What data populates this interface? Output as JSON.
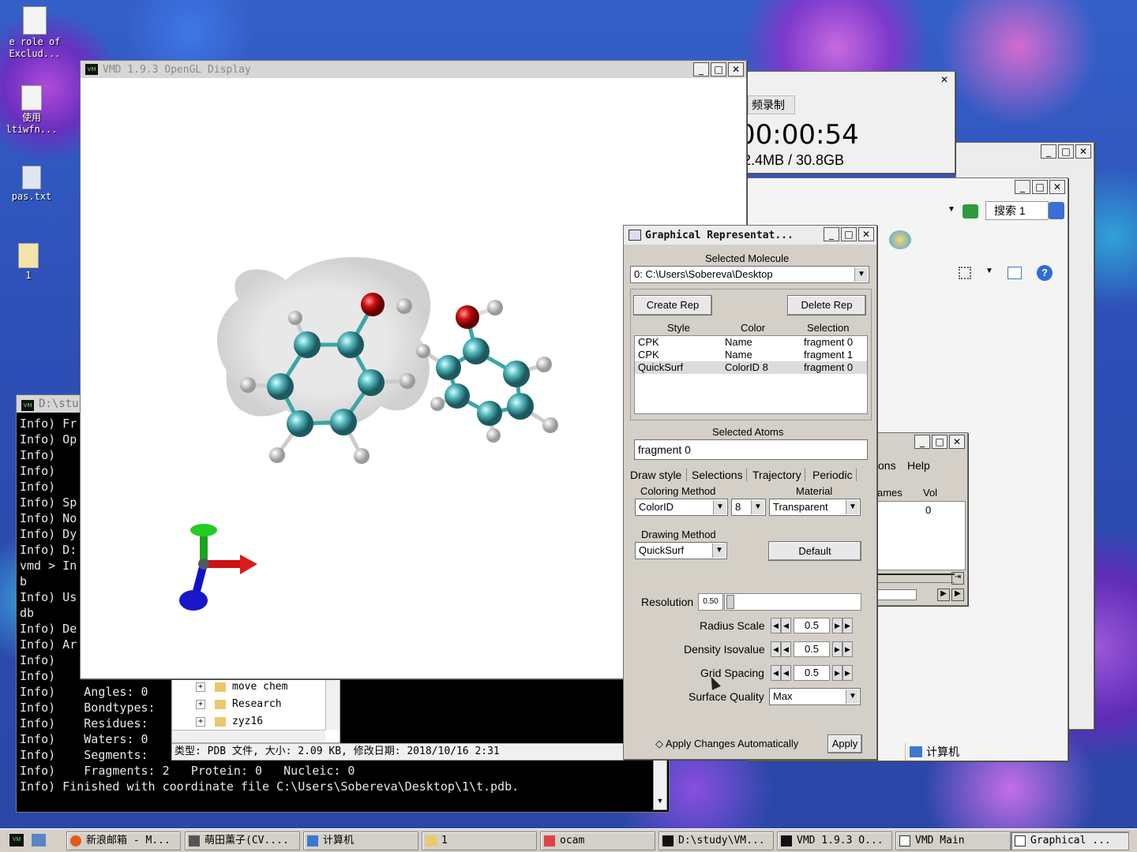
{
  "desktop_icons": [
    {
      "label1": "e role of",
      "label2": "Exclud..."
    },
    {
      "label1": "使用",
      "label2": "ltiwfn..."
    },
    {
      "label1": "pas.txt",
      "label2": ""
    },
    {
      "label1": "1",
      "label2": ""
    }
  ],
  "opengl": {
    "title": "VMD 1.9.3 OpenGL Display"
  },
  "recorder": {
    "tab": "频录制",
    "time": "00:00:54",
    "size": "2.4MB / 30.8GB"
  },
  "explorer": {
    "search_label": "搜索 1",
    "tree": [
      "move chem",
      "Research",
      "zyz16"
    ],
    "status": "类型: PDB 文件, 大小: 2.09 KB, 修改日期: 2018/10/16 2:31",
    "footer": "计算机"
  },
  "vmdmain": {
    "menu": [
      "ons",
      "Help"
    ],
    "cols": [
      "ames",
      "Vol"
    ],
    "vol": "0"
  },
  "terminal": {
    "title": "D:\\stu",
    "lines": [
      "Info) Fr",
      "Info) Op",
      "Info)",
      "Info)",
      "Info)",
      "Info) Sp",
      "Info) No",
      "Info) Dy",
      "Info) D:",
      "vmd > In",
      "b",
      "Info) Us",
      "db",
      "Info) De",
      "Info) Ar",
      "Info)",
      "Info)",
      "Info)    Angles: 0",
      "Info)    Bondtypes:",
      "Info)    Residues:",
      "Info)    Waters: 0",
      "Info)    Segments:",
      "Info)    Fragments: 2   Protein: 0   Nucleic: 0",
      "Info) Finished with coordinate file C:\\Users\\Sobereva\\Desktop\\1\\t.pdb."
    ]
  },
  "gr": {
    "title": "Graphical Representat...",
    "selected_molecule_label": "Selected Molecule",
    "selected_molecule": "0: C:\\Users\\Sobereva\\Desktop",
    "create_rep": "Create Rep",
    "delete_rep": "Delete Rep",
    "headers": {
      "style": "Style",
      "color": "Color",
      "selection": "Selection"
    },
    "reps": [
      {
        "style": "CPK",
        "color": "Name",
        "selection": "fragment 0"
      },
      {
        "style": "CPK",
        "color": "Name",
        "selection": "fragment 1"
      },
      {
        "style": "QuickSurf",
        "color": "ColorID 8",
        "selection": "fragment 0"
      }
    ],
    "selected_atoms_label": "Selected Atoms",
    "selected_atoms": "fragment 0",
    "tabs": [
      "Draw style",
      "Selections",
      "Trajectory",
      "Periodic"
    ],
    "coloring_label": "Coloring Method",
    "coloring": "ColorID",
    "color_id": "8",
    "material_label": "Material",
    "material": "Transparent",
    "drawing_label": "Drawing Method",
    "drawing": "QuickSurf",
    "default_btn": "Default",
    "resolution_label": "Resolution",
    "resolution": "0.50",
    "radius_label": "Radius Scale",
    "radius": "0.5",
    "density_label": "Density Isovalue",
    "density": "0.5",
    "grid_label": "Grid Spacing",
    "grid": "0.5",
    "quality_label": "Surface Quality",
    "quality": "Max",
    "apply_auto": "Apply Changes Automatically",
    "apply": "Apply"
  },
  "taskbar": [
    "新浪邮箱 - M...",
    "萌田薰子(CV....",
    "计算机",
    "1",
    "ocam",
    "D:\\study\\VM...",
    "VMD 1.9.3 O...",
    "VMD Main",
    "Graphical ..."
  ]
}
